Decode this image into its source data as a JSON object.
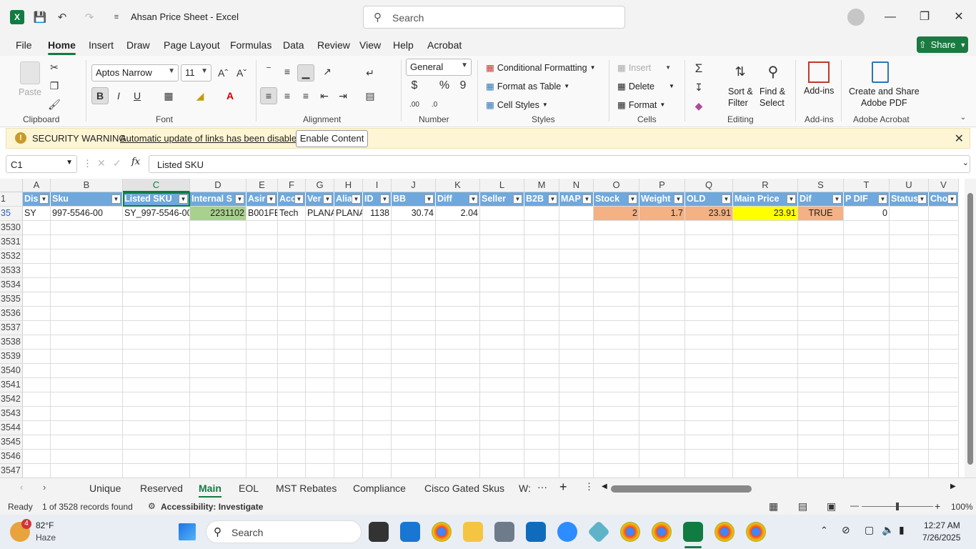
{
  "window": {
    "title": "Ahsan Price Sheet  -  Excel",
    "search_placeholder": "Search"
  },
  "menu_tabs": [
    "File",
    "Home",
    "Insert",
    "Draw",
    "Page Layout",
    "Formulas",
    "Data",
    "Review",
    "View",
    "Help",
    "Acrobat"
  ],
  "share_label": "Share",
  "ribbon": {
    "clipboard": {
      "paste": "Paste",
      "label": "Clipboard"
    },
    "font": {
      "name": "Aptos Narrow",
      "size": "11",
      "label": "Font"
    },
    "alignment": {
      "label": "Alignment"
    },
    "number": {
      "format": "General",
      "label": "Number"
    },
    "styles": {
      "conditional": "Conditional Formatting",
      "format_table": "Format as Table",
      "cell_styles": "Cell Styles",
      "label": "Styles"
    },
    "cells": {
      "insert": "Insert",
      "delete": "Delete",
      "format": "Format",
      "label": "Cells"
    },
    "editing": {
      "sort_filter_1": "Sort &",
      "sort_filter_2": "Filter",
      "find_select_1": "Find &",
      "find_select_2": "Select",
      "label": "Editing"
    },
    "addins": {
      "btn": "Add-ins",
      "label": "Add-ins"
    },
    "acrobat": {
      "btn1": "Create and Share",
      "btn2": "Adobe PDF",
      "label": "Adobe Acrobat"
    }
  },
  "security": {
    "title": "SECURITY WARNING",
    "message": "Automatic update of links has been disabled",
    "button": "Enable Content"
  },
  "formula_bar": {
    "name_box": "C1",
    "fx": "fx",
    "content": "Listed SKU"
  },
  "grid": {
    "columns": [
      "A",
      "B",
      "C",
      "D",
      "E",
      "F",
      "G",
      "H",
      "I",
      "J",
      "K",
      "L",
      "M",
      "N",
      "O",
      "P",
      "Q",
      "R",
      "S",
      "T",
      "U",
      "V"
    ],
    "header_row_number": "1",
    "headers": [
      "Dis",
      "Sku",
      "Listed SKU",
      "Internal S",
      "Asir",
      "Acc",
      "Ver",
      "Alia",
      "ID",
      "BB",
      "Diff",
      "Seller",
      "B2B",
      "MAP",
      "Stock",
      "Weight",
      "OLD",
      "Main Price",
      "Dif",
      "P DIF",
      "Status",
      "Cho"
    ],
    "data_row_number": "35",
    "data_row": [
      "SY",
      "997-5546-00",
      "SY_997-5546-00",
      "2231102",
      "B001FE",
      "Tech",
      "PLANA",
      "PLANA",
      "1138",
      "30.74",
      "2.04",
      "",
      "",
      "",
      "2",
      "1.7",
      "23.91",
      "23.91",
      "TRUE",
      "0",
      "",
      ""
    ],
    "empty_rows": [
      "3530",
      "3531",
      "3532",
      "3533",
      "3534",
      "3535",
      "3536",
      "3537",
      "3538",
      "3539",
      "3540",
      "3541",
      "3542",
      "3543",
      "3544",
      "3545",
      "3546",
      "3547"
    ]
  },
  "sheet_tabs": [
    "Unique",
    "Reserved",
    "Main",
    "EOL",
    "MST Rebates",
    "Compliance",
    "Cisco Gated Skus",
    "W:"
  ],
  "active_sheet": "Main",
  "status": {
    "mode": "Ready",
    "records": "1 of 3528 records found",
    "accessibility": "Accessibility: Investigate",
    "zoom": "100%"
  },
  "taskbar": {
    "temp": "82°F",
    "weather": "Haze",
    "badge": "4",
    "search": "Search",
    "time": "12:27 AM",
    "date": "7/26/2025"
  },
  "colors": {
    "header_fill": "#6fa8dc",
    "green_fill": "#a9d18e",
    "orange_fill": "#f4b183",
    "yellow_fill": "#ffff00",
    "excel_green": "#107c41"
  }
}
